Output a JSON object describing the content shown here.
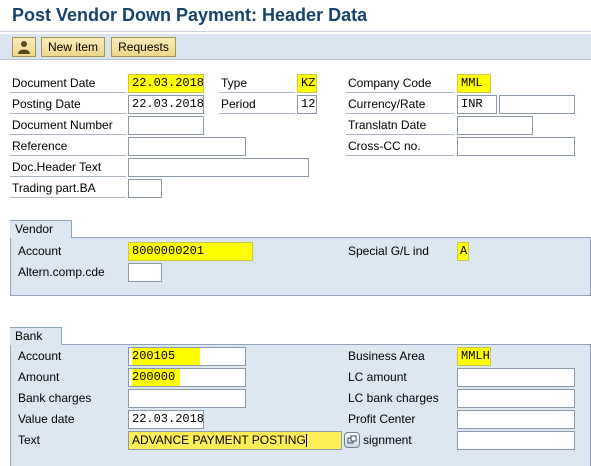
{
  "window": {
    "title": "Post Vendor Down Payment: Header Data"
  },
  "toolbar": {
    "new_item_label": "New item",
    "requests_label": "Requests"
  },
  "header": {
    "document_date_label": "Document Date",
    "document_date_value": "22.03.2018",
    "type_label": "Type",
    "type_value": "KZ",
    "company_code_label": "Company Code",
    "company_code_value": "MML",
    "posting_date_label": "Posting Date",
    "posting_date_value": "22.03.2018",
    "period_label": "Period",
    "period_value": "12",
    "currency_label": "Currency/Rate",
    "currency_value": "INR",
    "rate_value": "",
    "document_number_label": "Document Number",
    "document_number_value": "",
    "translatn_date_label": "Translatn Date",
    "translatn_date_value": "",
    "reference_label": "Reference",
    "reference_value": "",
    "cross_cc_label": "Cross-CC no.",
    "cross_cc_value": "",
    "doc_header_text_label": "Doc.Header Text",
    "doc_header_text_value": "",
    "trading_part_label": "Trading part.BA",
    "trading_part_value": ""
  },
  "vendor": {
    "group_title": "Vendor",
    "account_label": "Account",
    "account_value": "8000000201",
    "special_gl_label": "Special G/L ind",
    "special_gl_value": "A",
    "altern_comp_label": "Altern.comp.cde",
    "altern_comp_value": ""
  },
  "bank": {
    "group_title": "Bank",
    "account_label": "Account",
    "account_value": "200105",
    "business_area_label": "Business Area",
    "business_area_value": "MMLH",
    "amount_label": "Amount",
    "amount_value": "200000",
    "lc_amount_label": "LC amount",
    "lc_amount_value": "",
    "bank_charges_label": "Bank charges",
    "bank_charges_value": "",
    "lc_bank_charges_label": "LC bank charges",
    "lc_bank_charges_value": "",
    "value_date_label": "Value date",
    "value_date_value": "22.03.2018",
    "profit_center_label": "Profit Center",
    "profit_center_value": "",
    "text_label": "Text",
    "text_value": "ADVANCE PAYMENT POSTING",
    "assignment_label": "signment",
    "assignment_value": ""
  },
  "icons": {
    "person_icon": "person-icon",
    "expand_icon": "expand-icon"
  }
}
